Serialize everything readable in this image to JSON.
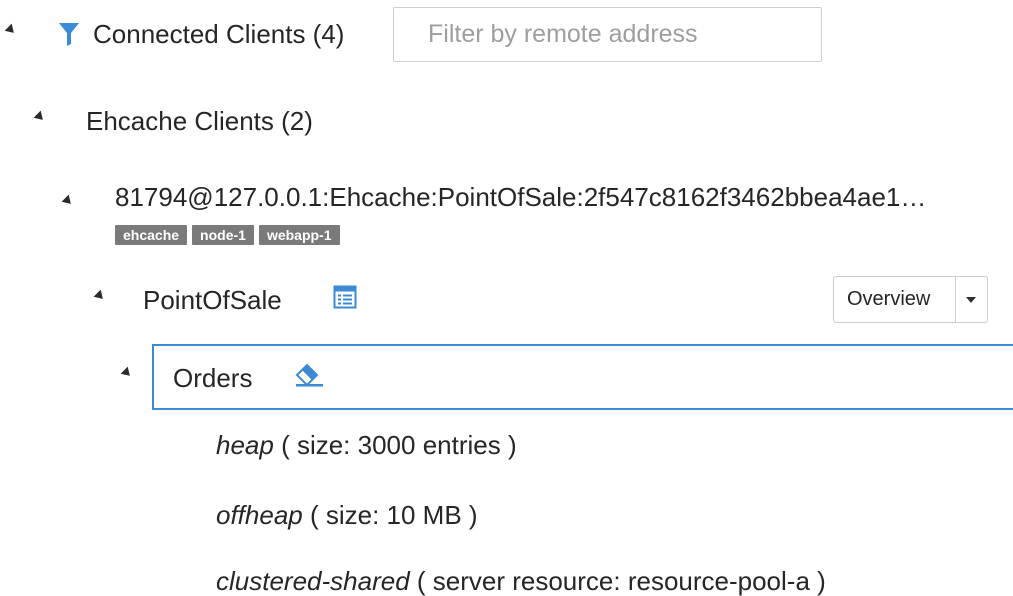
{
  "connected_clients": {
    "label": "Connected Clients (4)",
    "filter_placeholder": "Filter by remote address",
    "filter_value": ""
  },
  "ehcache_clients": {
    "label": "Ehcache Clients (2)"
  },
  "client": {
    "id": "81794@127.0.0.1:Ehcache:PointOfSale:2f547c8162f3462bbea4ae1…",
    "tags": [
      "ehcache",
      "node-1",
      "webapp-1"
    ]
  },
  "cache_manager": {
    "name": "PointOfSale",
    "view_selected": "Overview"
  },
  "cache": {
    "name": "Orders",
    "tiers": [
      {
        "name": "heap",
        "detail": " ( size: 3000 entries )"
      },
      {
        "name": "offheap",
        "detail": " ( size: 10 MB )"
      },
      {
        "name": "clustered-shared",
        "detail": " ( server resource: resource-pool-a )"
      }
    ]
  },
  "colors": {
    "accent": "#3b8ad6",
    "tag_bg": "#7a7a7a",
    "text": "#262626"
  },
  "icons": {
    "filter": "filter-icon",
    "details": "details-list-icon",
    "clear": "eraser-icon"
  }
}
